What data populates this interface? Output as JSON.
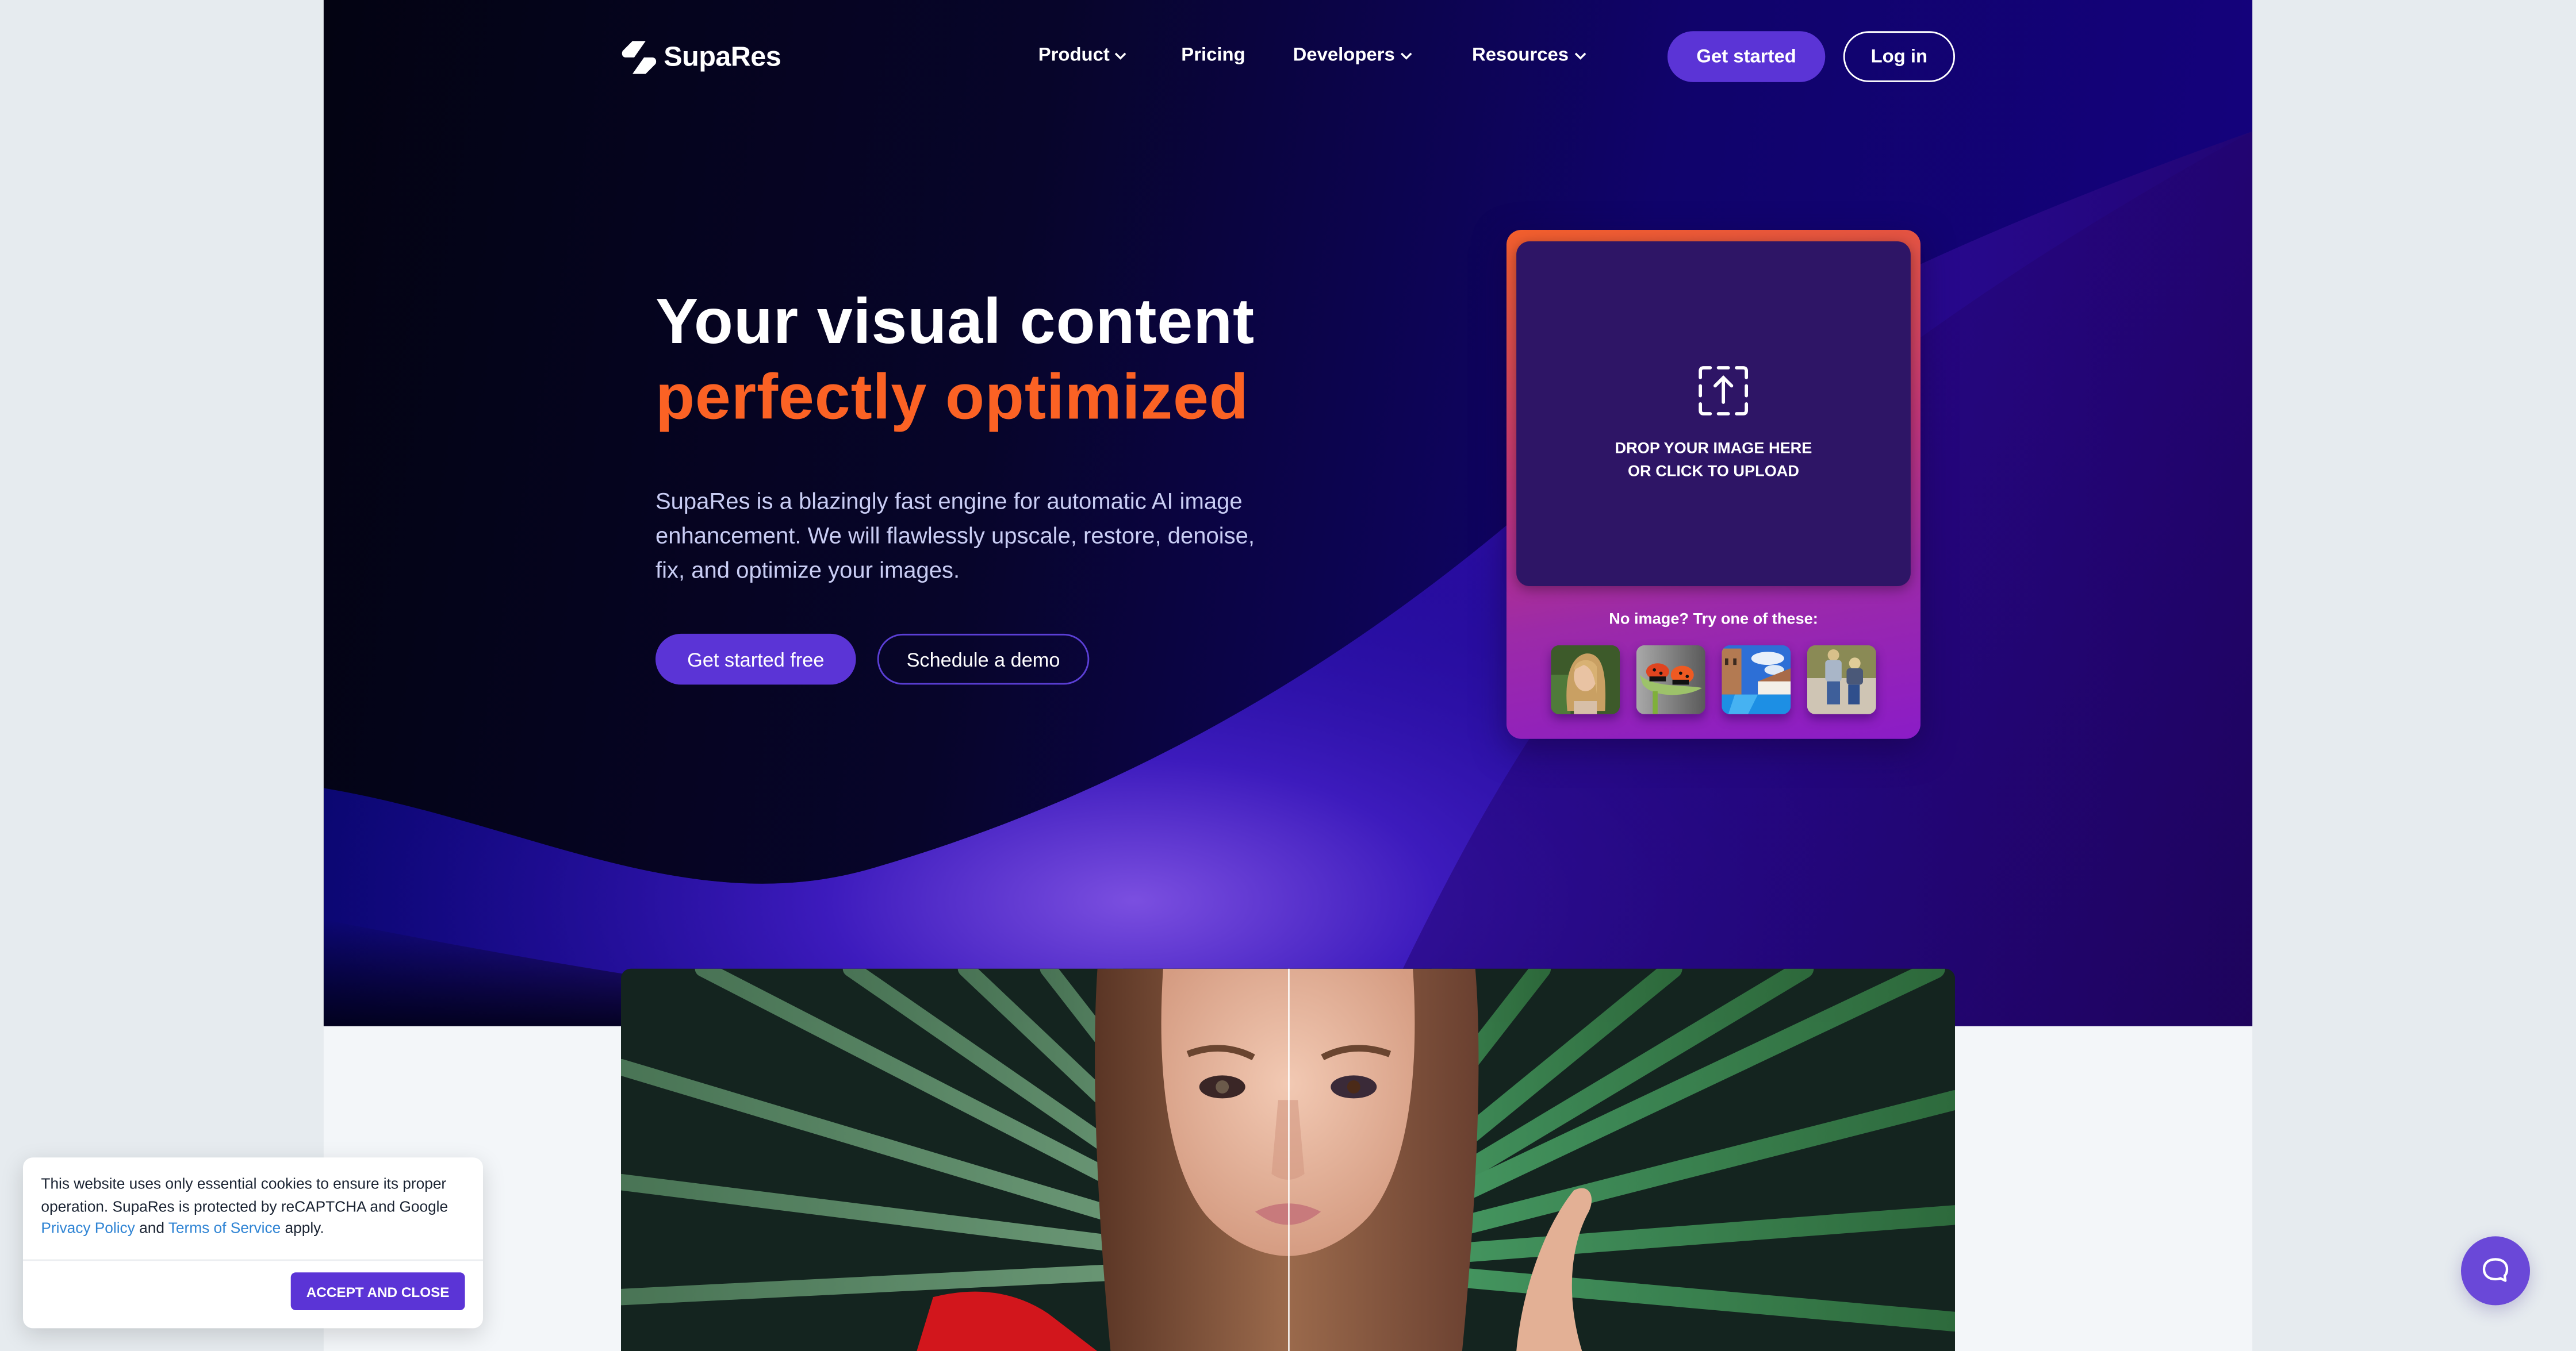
{
  "brand": {
    "name": "SupaRes",
    "accent": "#5b34d6",
    "highlight": "#fb6224"
  },
  "nav": {
    "items": [
      {
        "label": "Product",
        "has_dropdown": true
      },
      {
        "label": "Pricing",
        "has_dropdown": false
      },
      {
        "label": "Developers",
        "has_dropdown": true
      },
      {
        "label": "Resources",
        "has_dropdown": true
      }
    ],
    "get_started": "Get started",
    "login": "Log in"
  },
  "hero": {
    "title_line1": "Your visual content",
    "title_line2": "perfectly optimized",
    "description": "SupaRes is a blazingly fast engine for automatic AI image enhancement. We will flawlessly upscale, restore, denoise, fix, and optimize your images.",
    "cta_primary": "Get started free",
    "cta_secondary": "Schedule a demo"
  },
  "upload": {
    "icon": "upload-icon",
    "line1": "DROP YOUR IMAGE HERE",
    "line2": "OR CLICK TO UPLOAD",
    "samples_label": "No image? Try one of these:",
    "samples": [
      {
        "name": "woman-portrait"
      },
      {
        "name": "ladybugs"
      },
      {
        "name": "pool-building"
      },
      {
        "name": "children-walking"
      }
    ]
  },
  "comparison": {
    "subject": "woman-with-palm-leaves",
    "split": 0.5
  },
  "cookie": {
    "text_before": "This website uses only essential cookies to ensure its proper operation. SupaRes is protected by reCAPTCHA and Google ",
    "privacy_link": "Privacy Policy",
    "text_mid": " and ",
    "terms_link": "Terms of Service",
    "text_after": " apply.",
    "accept": "ACCEPT AND CLOSE"
  },
  "chat": {
    "icon": "chat-bubble-icon"
  }
}
